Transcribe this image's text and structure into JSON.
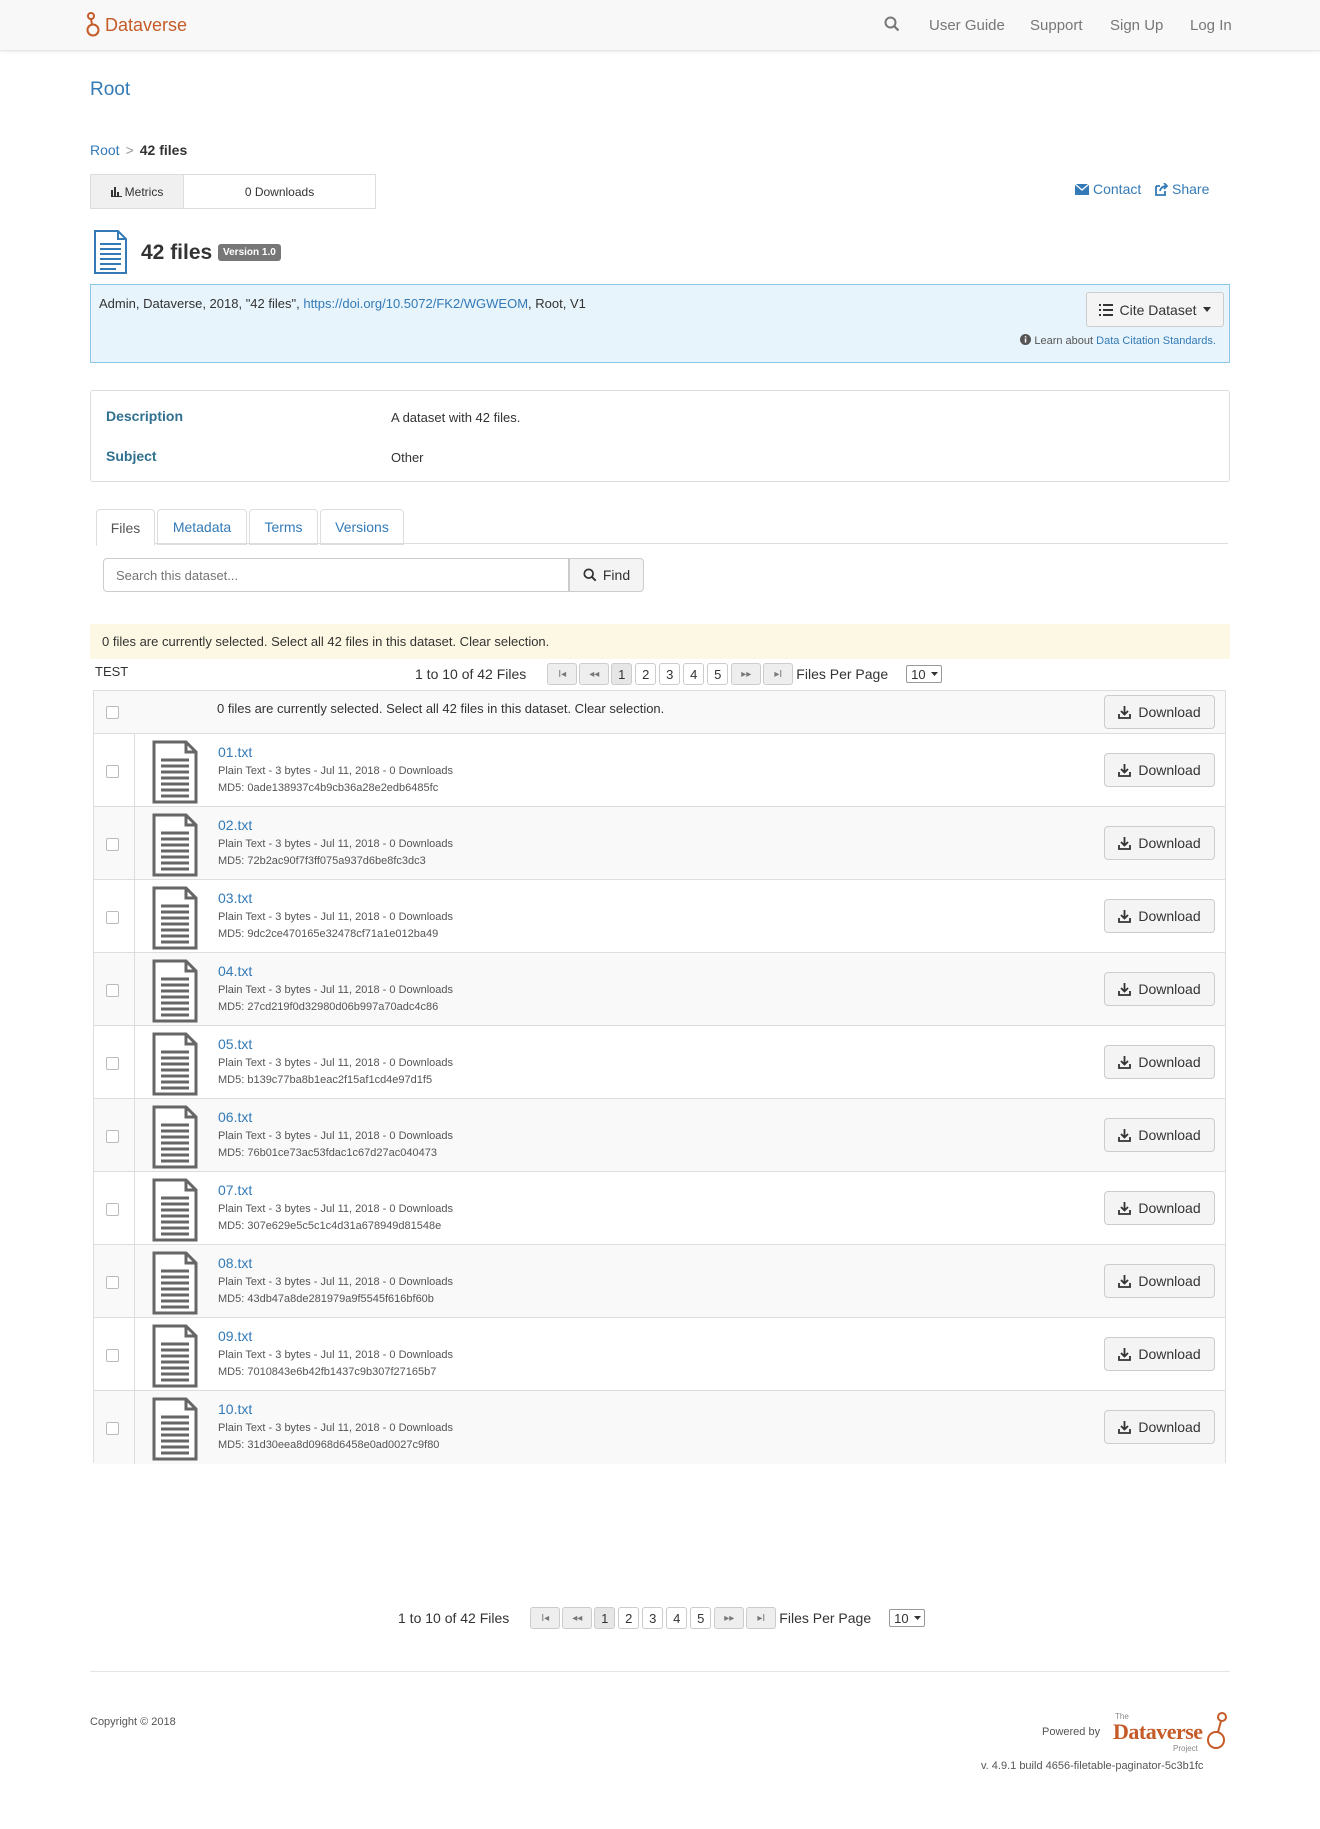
{
  "navbar": {
    "brand": "Dataverse",
    "links": [
      "User Guide",
      "Support",
      "Sign Up",
      "Log In"
    ]
  },
  "header": {
    "root_title": "Root",
    "breadcrumb": {
      "root": "Root",
      "separator": ">",
      "current": "42 files"
    }
  },
  "metrics": {
    "label": "Metrics",
    "value": "0 Downloads"
  },
  "actions": {
    "contact": "Contact",
    "share": "Share"
  },
  "dataset": {
    "title": "42 files",
    "version": "Version 1.0",
    "citation_prefix": "Admin, Dataverse, 2018, \"42 files\", ",
    "citation_doi": "https://doi.org/10.5072/FK2/WGWEOM",
    "citation_suffix": ", Root, V1",
    "cite_button": "Cite Dataset",
    "learn_prefix": "Learn about ",
    "learn_link": "Data Citation Standards."
  },
  "metadata": {
    "description_label": "Description",
    "description_value": "A dataset with 42 files.",
    "subject_label": "Subject",
    "subject_value": "Other"
  },
  "tabs": [
    {
      "label": "Files",
      "active": true
    },
    {
      "label": "Metadata",
      "active": false
    },
    {
      "label": "Terms",
      "active": false
    },
    {
      "label": "Versions",
      "active": false
    }
  ],
  "search": {
    "placeholder": "Search this dataset...",
    "button": "Find"
  },
  "selection_banner": "0 files are currently selected. Select all 42 files in this dataset. Clear selection.",
  "test_label": "TEST",
  "pager": {
    "range": "1 to 10 of 42 Files",
    "first": "I◂",
    "prev": "◂◂",
    "pages": [
      "1",
      "2",
      "3",
      "4",
      "5"
    ],
    "next": "▸▸",
    "last": "▸I",
    "per_page_label": "Files Per Page",
    "per_page_value": "10"
  },
  "table": {
    "header_selection_text": "0 files are currently selected. Select all 42 files in this dataset. Clear selection.",
    "download_label": "Download",
    "files": [
      {
        "name": "01.txt",
        "meta": "Plain Text - 3 bytes - Jul 11, 2018 - 0 Downloads",
        "md5": "MD5: 0ade138937c4b9cb36a28e2edb6485fc"
      },
      {
        "name": "02.txt",
        "meta": "Plain Text - 3 bytes - Jul 11, 2018 - 0 Downloads",
        "md5": "MD5: 72b2ac90f7f3ff075a937d6be8fc3dc3"
      },
      {
        "name": "03.txt",
        "meta": "Plain Text - 3 bytes - Jul 11, 2018 - 0 Downloads",
        "md5": "MD5: 9dc2ce470165e32478cf71a1e012ba49"
      },
      {
        "name": "04.txt",
        "meta": "Plain Text - 3 bytes - Jul 11, 2018 - 0 Downloads",
        "md5": "MD5: 27cd219f0d32980d06b997a70adc4c86"
      },
      {
        "name": "05.txt",
        "meta": "Plain Text - 3 bytes - Jul 11, 2018 - 0 Downloads",
        "md5": "MD5: b139c77ba8b1eac2f15af1cd4e97d1f5"
      },
      {
        "name": "06.txt",
        "meta": "Plain Text - 3 bytes - Jul 11, 2018 - 0 Downloads",
        "md5": "MD5: 76b01ce73ac53fdac1c67d27ac040473"
      },
      {
        "name": "07.txt",
        "meta": "Plain Text - 3 bytes - Jul 11, 2018 - 0 Downloads",
        "md5": "MD5: 307e629e5c5c1c4d31a678949d81548e"
      },
      {
        "name": "08.txt",
        "meta": "Plain Text - 3 bytes - Jul 11, 2018 - 0 Downloads",
        "md5": "MD5: 43db47a8de281979a9f5545f616bf60b"
      },
      {
        "name": "09.txt",
        "meta": "Plain Text - 3 bytes - Jul 11, 2018 - 0 Downloads",
        "md5": "MD5: 7010843e6b42fb1437c9b307f27165b7"
      },
      {
        "name": "10.txt",
        "meta": "Plain Text - 3 bytes - Jul 11, 2018 - 0 Downloads",
        "md5": "MD5: 31d30eea8d0968d6458e0ad0027c9f80"
      }
    ]
  },
  "footer": {
    "copyright": "Copyright © 2018",
    "powered_by": "Powered by",
    "logo_the": "The",
    "logo_name": "Dataverse",
    "logo_project": "Project",
    "version": "v. 4.9.1 build 4656-filetable-paginator-5c3b1fc"
  },
  "colors": {
    "brand": "#c55b28",
    "link": "#337ab7",
    "citation_bg": "#e7f4fb",
    "banner_bg": "#fcf8e3"
  },
  "icons": [
    "search-icon",
    "bar-chart-icon",
    "envelope-icon",
    "share-icon",
    "document-icon",
    "list-icon",
    "caret-down-icon",
    "info-icon",
    "download-icon",
    "file-text-icon"
  ]
}
